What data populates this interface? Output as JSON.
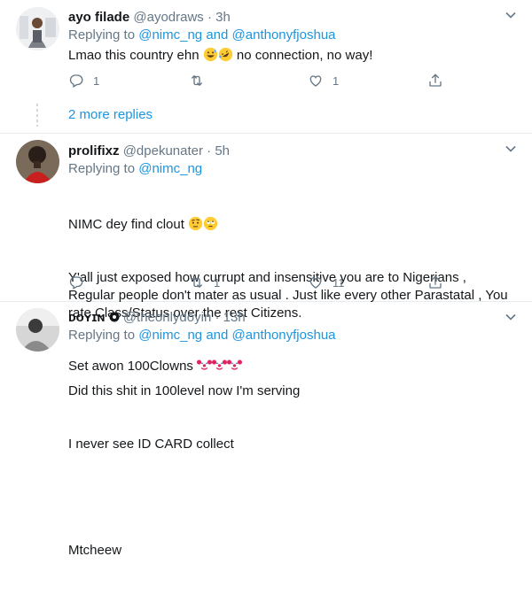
{
  "tweets": [
    {
      "name": "ayo filade",
      "handle": "@ayodraws",
      "time": "3h",
      "replying_label": "Replying to",
      "replying_to": [
        "@nimc_ng",
        "@anthonyfjoshua"
      ],
      "and_word": "and",
      "text_before": "Lmao this country ehn ",
      "emojis": [
        "grinning-sweat-emoji",
        "rolling-laughing-emoji"
      ],
      "text_after": " no connection, no way!",
      "reply_count": "1",
      "retweet_count": "",
      "like_count": "1"
    },
    {
      "name": "prolifixz",
      "handle": "@dpekunater",
      "time": "5h",
      "replying_label": "Replying to",
      "replying_to": [
        "@nimc_ng"
      ],
      "line1": "NIMC dey find clout",
      "line1_emojis": [
        "face-with-raised-eyebrow-emoji",
        "eye-roll-emoji"
      ],
      "paragraph": "Y'all just exposed how currupt and insensitive you are to Nigerians , Regular people don't mater as usual . Just like every other Parastatal , You rate Class/Status over the rest Citizens.",
      "line3": "Set awon 100Clowns",
      "line3_emojis": [
        "clown-emoji",
        "clown-emoji",
        "clown-emoji"
      ],
      "reply_count": "",
      "retweet_count": "1",
      "like_count": "11"
    },
    {
      "name": "ᴅᴏʏɪɴ",
      "handle": "@theonlydoyin",
      "time": "13h",
      "replying_label": "Replying to",
      "replying_to": [
        "@nimc_ng",
        "@anthonyfjoshua"
      ],
      "and_word": "and",
      "line1": "Did this shit in 100level now I'm serving",
      "line2": "I never see ID CARD collect",
      "line3": "Mtcheew"
    }
  ],
  "thread": {
    "more_replies": "2 more replies"
  },
  "separator": "·",
  "colors": {
    "link": "#1b95e0",
    "muted": "#657786",
    "border": "#e6ecf0"
  }
}
